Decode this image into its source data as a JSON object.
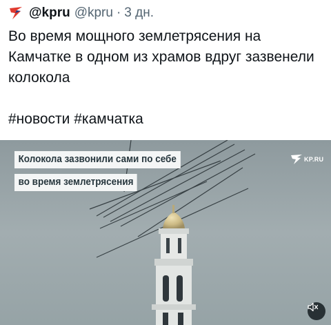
{
  "post": {
    "display_name": "@kpru",
    "handle": "@kpru",
    "separator": "·",
    "time": "3 дн.",
    "text": "Во время мощного землетрясения на Камчатке в одном из храмов вдруг зазвенели колокола\n\n#новости #камчатка",
    "logo_icon": "kp-arrow-icon"
  },
  "media": {
    "caption_line1": "Колокола зазвонили сами по себе",
    "caption_line2": "во время землетрясения",
    "brand": "KP.RU",
    "mute_icon": "speaker-muted-icon",
    "colors": {
      "sky": "#9aa6aa",
      "caption_bg": "#f4f6f6",
      "caption_text": "#26363d",
      "dome": "#c9b98a"
    }
  },
  "colors": {
    "accent_red": "#e03a2f",
    "muted_text": "#536471",
    "text": "#0f1419"
  }
}
